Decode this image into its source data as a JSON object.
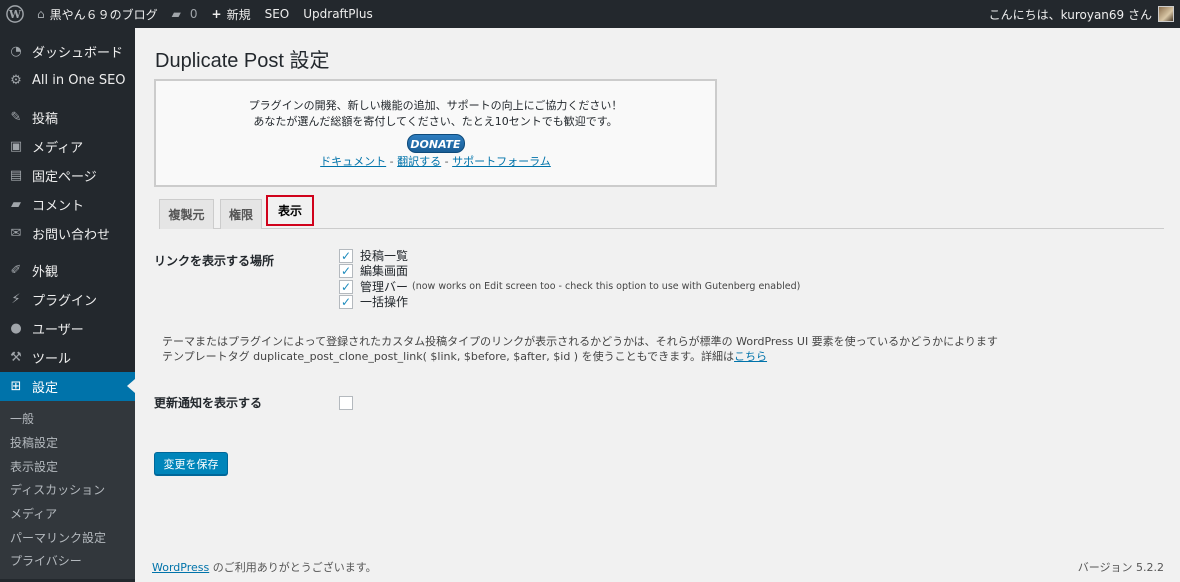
{
  "adminbar": {
    "site_name": "黒やん６９のブログ",
    "comments_count": "0",
    "new_label": "新規",
    "seo_label": "SEO",
    "updraft_label": "UpdraftPlus",
    "greeting": "こんにちは、kuroyan69 さん"
  },
  "sidebar": {
    "items": [
      {
        "label": "ダッシュボード",
        "icon": "dashboard-icon"
      },
      {
        "label": "All in One SEO",
        "icon": "gear-icon"
      },
      {
        "label": "投稿",
        "icon": "pin-icon"
      },
      {
        "label": "メディア",
        "icon": "media-icon"
      },
      {
        "label": "固定ページ",
        "icon": "page-icon"
      },
      {
        "label": "コメント",
        "icon": "comment-icon"
      },
      {
        "label": "お問い合わせ",
        "icon": "mail-icon"
      },
      {
        "label": "外観",
        "icon": "brush-icon"
      },
      {
        "label": "プラグイン",
        "icon": "plugin-icon"
      },
      {
        "label": "ユーザー",
        "icon": "user-icon"
      },
      {
        "label": "ツール",
        "icon": "wrench-icon"
      },
      {
        "label": "設定",
        "icon": "settings-icon"
      }
    ],
    "submenu": [
      "一般",
      "投稿設定",
      "表示設定",
      "ディスカッション",
      "メディア",
      "パーマリンク設定",
      "プライバシー"
    ]
  },
  "main": {
    "title": "Duplicate Post 設定",
    "donate": {
      "line1": "プラグインの開発、新しい機能の追加、サポートの向上にご協力ください！",
      "line2": "あなたが選んだ総額を寄付してください、たとえ10セントでも歓迎です。",
      "button": "DONATE",
      "link_docs": "ドキュメント",
      "link_translate": "翻訳する",
      "link_support": "サポートフォーラム",
      "separator": "-"
    },
    "tabs": [
      "複製元",
      "権限",
      "表示"
    ],
    "active_tab": "表示",
    "link_location_label": "リンクを表示する場所",
    "checkboxes": [
      {
        "label": "投稿一覧",
        "checked": true
      },
      {
        "label": "編集画面",
        "checked": true
      },
      {
        "label": "管理バー",
        "note": "(now works on Edit screen too - check this option to use with Gutenberg enabled)",
        "checked": true
      },
      {
        "label": "一括操作",
        "checked": true
      }
    ],
    "desc_line1": "テーマまたはプラグインによって登録されたカスタム投稿タイプのリンクが表示されるかどうかは、それらが標準の WordPress UI 要素を使っているかどうかによります",
    "desc_line2": "テンプレートタグ duplicate_post_clone_post_link( $link, $before, $after, $id ) を使うこともできます。詳細は",
    "desc_link": "こちら",
    "update_notice_label": "更新通知を表示する",
    "update_notice_checked": false,
    "save_button": "変更を保存"
  },
  "footer": {
    "wp_link": "WordPress",
    "thanks": " のご利用ありがとうございます。",
    "version": "バージョン 5.2.2"
  },
  "colors": {
    "accent": "#0073aa",
    "sidebar_bg": "#23282d",
    "highlight_border": "#d0021b"
  }
}
